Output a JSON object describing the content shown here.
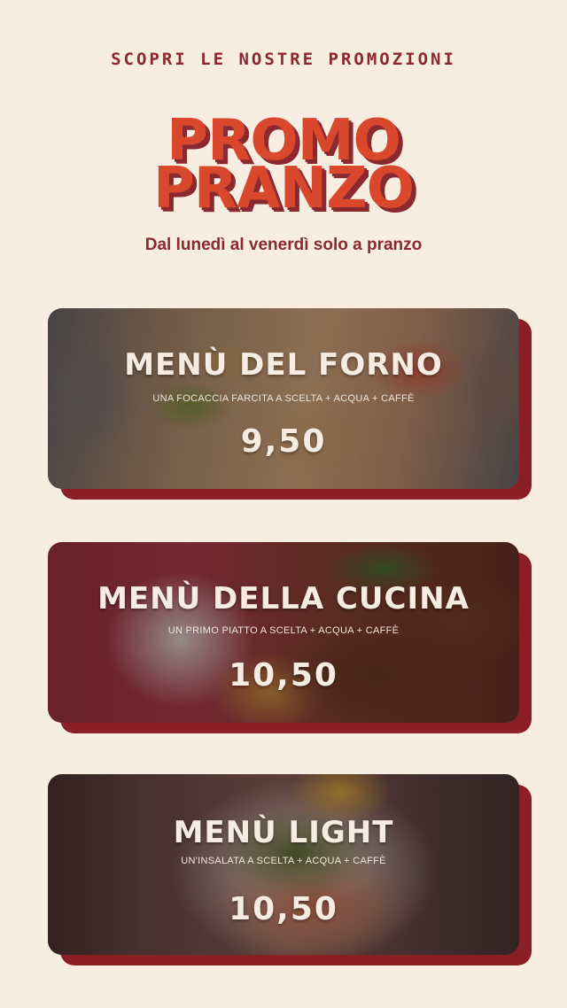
{
  "header": {
    "eyebrow": "SCOPRI LE NOSTRE PROMOZIONI",
    "title_line1": "PROMO",
    "title_line2": "PRANZO",
    "subtitle": "Dal lunedì al venerdì solo a pranzo"
  },
  "menus": [
    {
      "title": "MENÙ DEL FORNO",
      "description": "UNA FOCACCIA FARCITA A SCELTA + ACQUA + CAFFÈ",
      "price": "9,50",
      "image": "focaccia-photo"
    },
    {
      "title": "MENÙ DELLA CUCINA",
      "description": "UN PRIMO PIATTO A SCELTA + ACQUA + CAFFÈ",
      "price": "10,50",
      "image": "pasta-photo"
    },
    {
      "title": "MENÙ LIGHT",
      "description": "UN'INSALATA A SCELTA + ACQUA + CAFFÈ",
      "price": "10,50",
      "image": "salad-photo"
    }
  ],
  "colors": {
    "background": "#f8ede1",
    "accent_red": "#d9472d",
    "dark_red": "#8a2a30",
    "card_shadow": "#8a1f25",
    "card_text": "#f6ece2"
  }
}
